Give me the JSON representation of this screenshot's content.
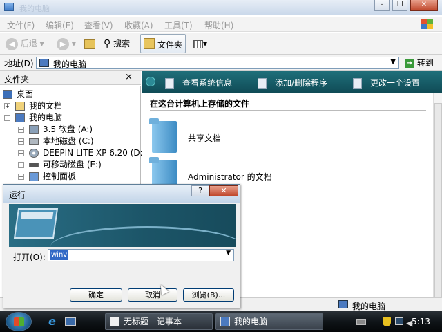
{
  "window": {
    "title": "我的电脑"
  },
  "menu": {
    "items": [
      "文件(F)",
      "编辑(E)",
      "查看(V)",
      "收藏(A)",
      "工具(T)",
      "帮助(H)"
    ]
  },
  "toolbar": {
    "back_label": "后退",
    "search_label": "搜索",
    "folders_label": "文件夹",
    "views_arrow": "▾"
  },
  "address": {
    "label": "地址(D)",
    "value": "我的电脑",
    "go_label": "转到"
  },
  "folders_pane": {
    "title": "文件夹",
    "close_glyph": "×",
    "tree": [
      "桌面",
      "我的文档",
      "我的电脑",
      "3.5 软盘 (A:)",
      "本地磁盘 (C:)",
      "DEEPIN LITE XP 6.20 (D:",
      "可移动磁盘 (E:)",
      "控制面板"
    ]
  },
  "tasks": {
    "items": [
      "查看系统信息",
      "添加/删除程序",
      "更改一个设置"
    ]
  },
  "content": {
    "section_title": "在这台计算机上存储的文件",
    "items": [
      "共享文档",
      "Administrator 的文档"
    ]
  },
  "status": {
    "location": "我的电脑"
  },
  "run_dialog": {
    "title": "运行",
    "help_glyph": "?",
    "close_glyph": "✕",
    "open_label": "打开(O):",
    "open_value": "winv",
    "ok_label": "确定",
    "cancel_label": "取消",
    "browse_label": "浏览(B)..."
  },
  "taskbar": {
    "windows": [
      "无标题 - 记事本",
      "我的电脑"
    ],
    "clock": "5:13"
  }
}
